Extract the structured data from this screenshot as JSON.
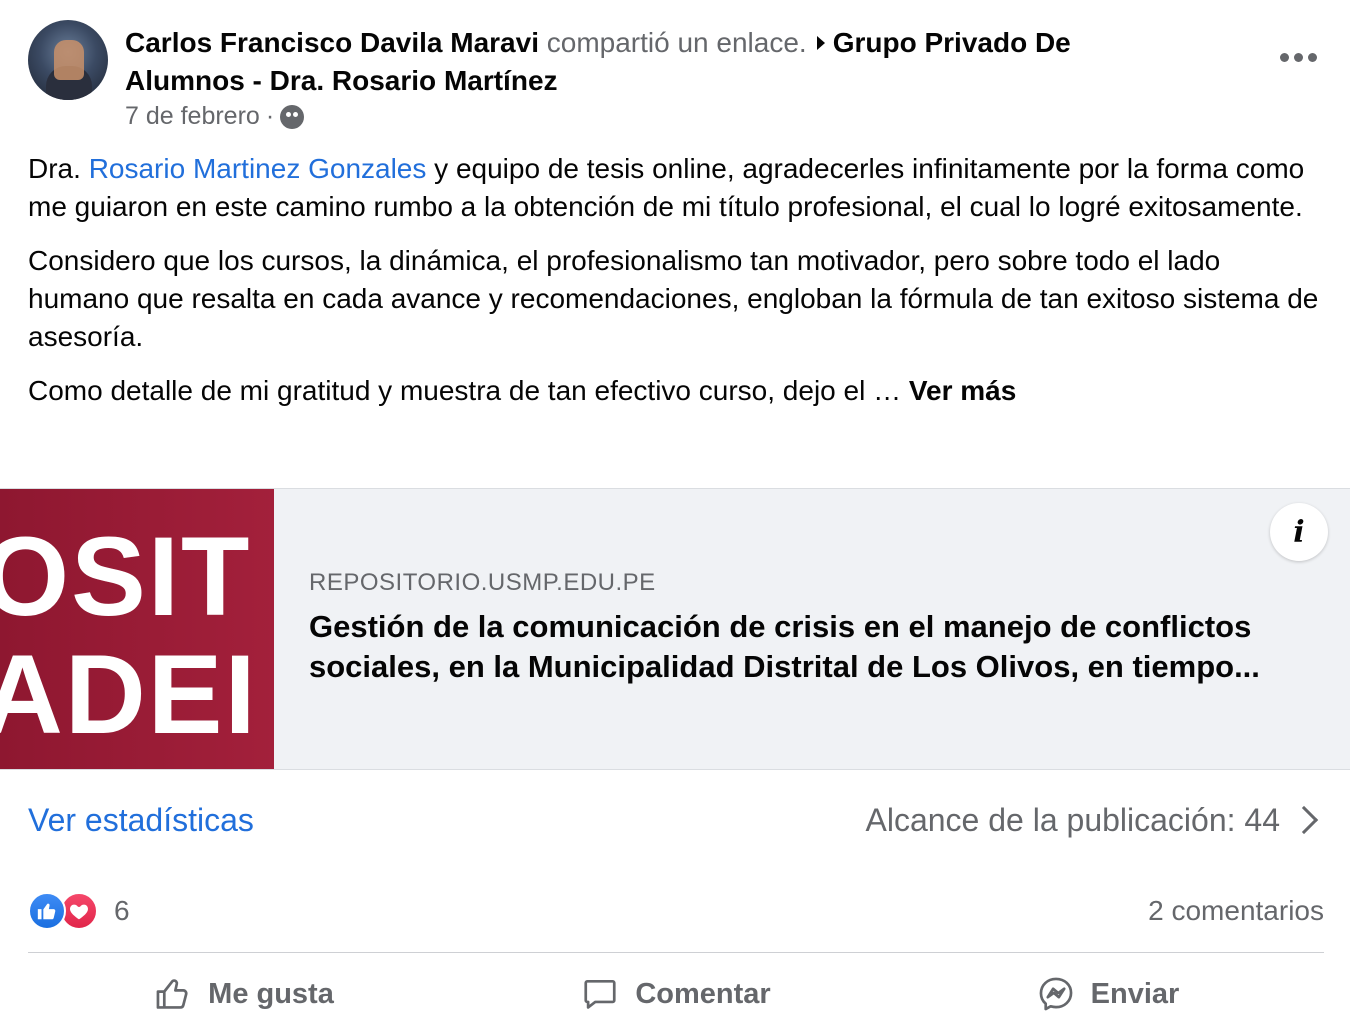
{
  "post": {
    "author": "Carlos Francisco Davila Maravi",
    "action_text": "compartió un enlace.",
    "group": "Grupo Privado De Alumnos - Dra. Rosario Martínez",
    "date": "7 de febrero",
    "date_sep": "·",
    "audience_icon": "group-audience-icon",
    "more_icon": "more-options-icon"
  },
  "body": {
    "p1_prefix": "Dra.",
    "p1_mention": "Rosario Martinez Gonzales",
    "p1_rest": "y equipo de tesis online, agradecerles infinitamente por la forma como me guiaron en este camino rumbo a la obtención de mi título profesional, el cual lo logré exitosamente.",
    "p2": "Considero que los cursos, la dinámica, el profesionalismo tan motivador, pero sobre todo el lado humano que resalta en cada avance y recomendaciones, engloban la fórmula de tan exitoso sistema de asesoría.",
    "p3": "Como detalle de mi gratitud y muestra de tan efectivo curso, dejo el …",
    "see_more": "Ver más"
  },
  "link_card": {
    "thumb_line1": "OSIT",
    "thumb_line2": "ADEI",
    "domain": "REPOSITORIO.USMP.EDU.PE",
    "title": "Gestión de la comunicación de crisis en el manejo de conflictos sociales, en la Municipalidad Distrital de Los Olivos, en tiempo...",
    "info_label": "i",
    "thumb_color": "#9b1d36"
  },
  "stats": {
    "view_stats": "Ver estadísticas",
    "reach_label": "Alcance de la publicación: 44"
  },
  "reactions": {
    "count": "6",
    "comments": "2 comentarios",
    "types": [
      "like-reaction-icon",
      "love-reaction-icon"
    ]
  },
  "actions": {
    "like": "Me gusta",
    "comment": "Comentar",
    "send": "Enviar"
  },
  "colors": {
    "link_blue": "#216fdb",
    "secondary_text": "#65676b",
    "card_bg": "#f0f2f5"
  }
}
